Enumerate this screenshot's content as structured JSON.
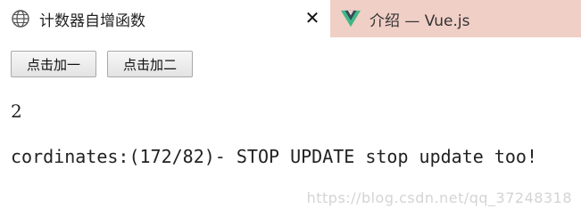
{
  "tabs": [
    {
      "title": "计数器自增函数",
      "icon": "globe-icon",
      "active": true,
      "close_label": "✕"
    },
    {
      "title": "介绍 — Vue.js",
      "icon": "vue-logo-icon",
      "active": false
    }
  ],
  "buttons": {
    "add_one": "点击加一",
    "add_two": "点击加二"
  },
  "count": "2",
  "coordinates_text": "cordinates:(172/82)- STOP UPDATE stop update too!",
  "watermark": "https://blog.csdn.net/qq_37248318",
  "colors": {
    "tabbar_bg": "#f0cfc6",
    "vue_green": "#41b883",
    "vue_dark": "#35495e"
  }
}
